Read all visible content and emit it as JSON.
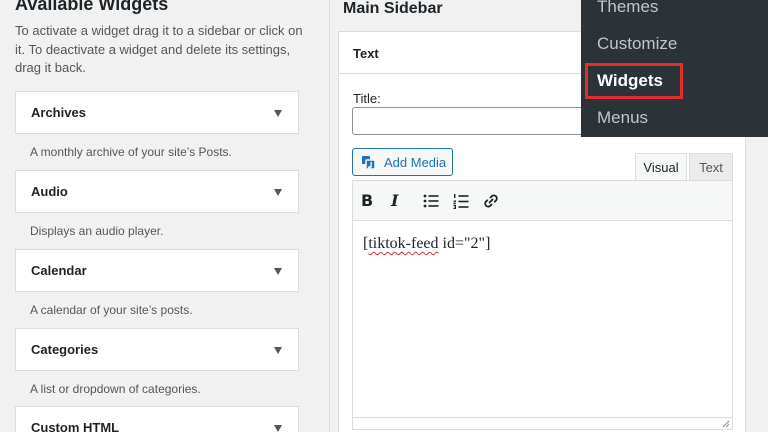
{
  "available": {
    "title": "Available Widgets",
    "description": "To activate a widget drag it to a sidebar or click on it. To deactivate a widget and delete its settings, drag it back.",
    "widgets": [
      {
        "name": "Archives",
        "desc": "A monthly archive of your site’s Posts."
      },
      {
        "name": "Audio",
        "desc": "Displays an audio player."
      },
      {
        "name": "Calendar",
        "desc": "A calendar of your site’s posts."
      },
      {
        "name": "Categories",
        "desc": "A list or dropdown of categories."
      },
      {
        "name": "Custom HTML",
        "desc": ""
      }
    ]
  },
  "sidebar": {
    "title": "Main Sidebar",
    "widget_title": "Text",
    "title_label": "Title:",
    "title_value": "",
    "add_media_label": "Add Media",
    "tabs": {
      "visual": "Visual",
      "text": "Text"
    },
    "content_prefix": "[",
    "content_misspelled": "tiktok-feed",
    "content_suffix": " id=\"2\"]"
  },
  "admin_menu": {
    "items": [
      "Themes",
      "Customize",
      "Widgets",
      "Menus"
    ],
    "active": "Widgets",
    "highlight_color": "#e02e2e"
  },
  "toolbar": {
    "bold": "B",
    "italic": "I",
    "icons": [
      "bulleted-list-icon",
      "numbered-list-icon",
      "link-icon"
    ]
  }
}
